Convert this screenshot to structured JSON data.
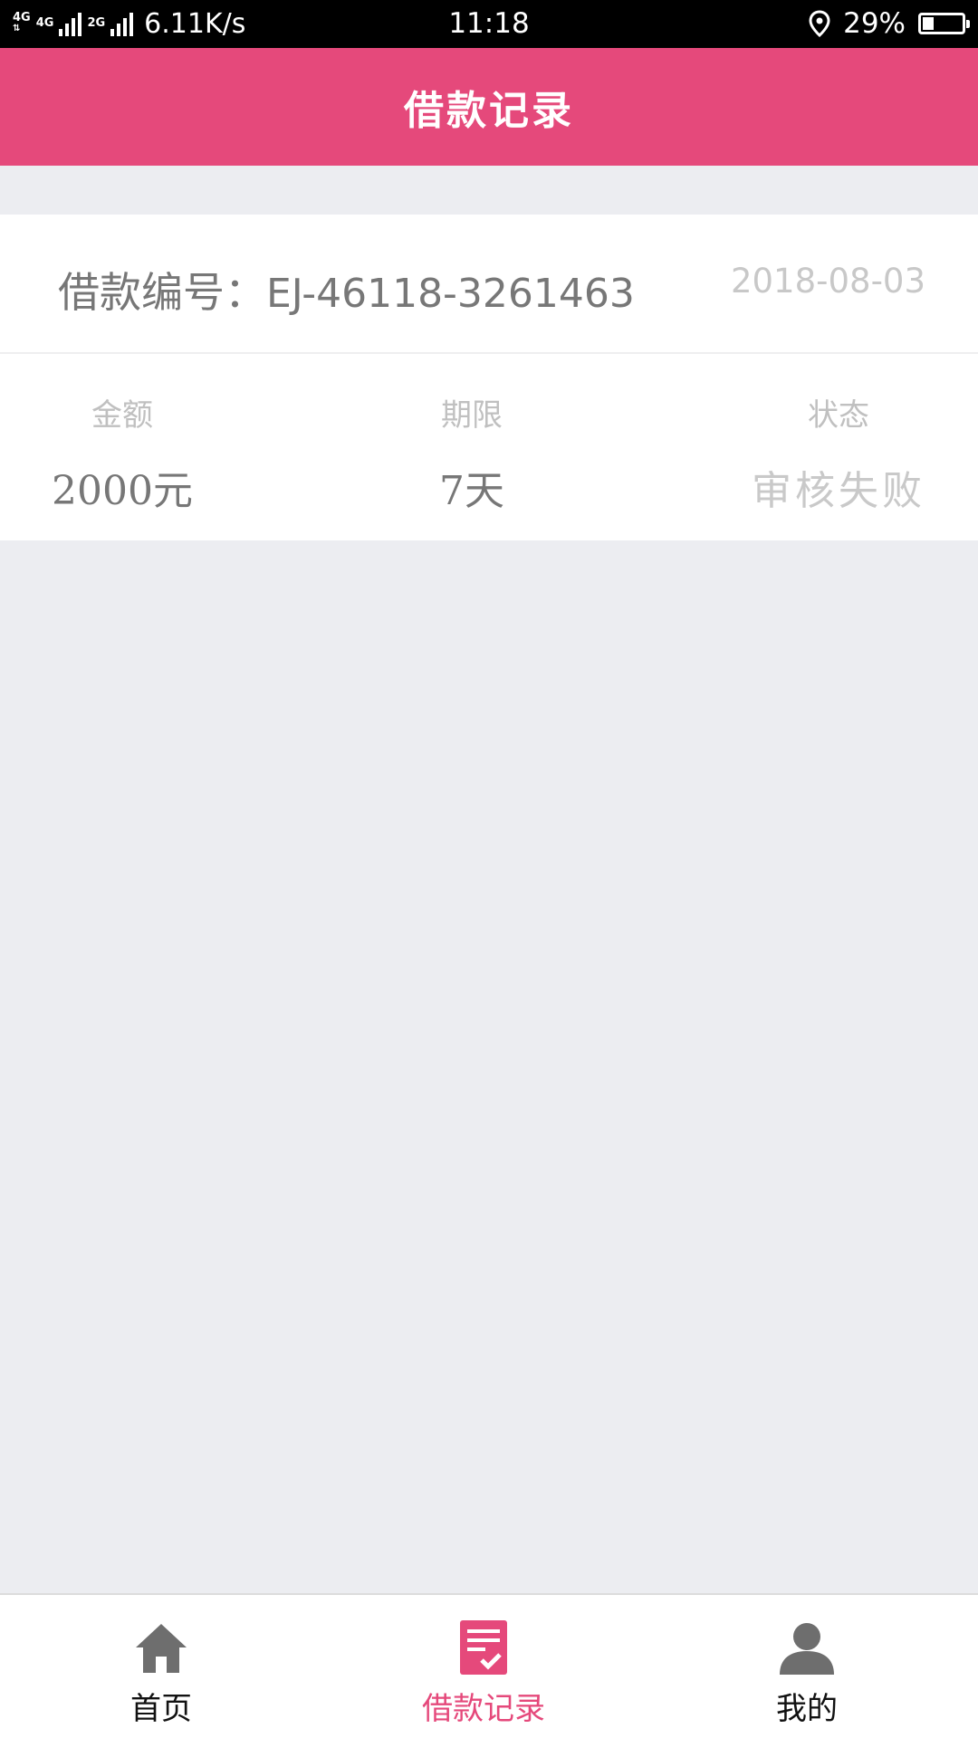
{
  "status_bar": {
    "network_1": "4G",
    "network_2": "4G",
    "network_3": "2G",
    "speed": "6.11K/s",
    "time": "11:18",
    "battery": "29%",
    "battery_level": 0.29
  },
  "header": {
    "title": "借款记录"
  },
  "loan": {
    "number_label": "借款编号：",
    "number": "EJ-46118-3261463",
    "date": "2018-08-03",
    "amount_label": "金额",
    "amount": "2000元",
    "term_label": "期限",
    "term": "7天",
    "status_label": "状态",
    "status": "审核失败"
  },
  "bottom_nav": {
    "items": [
      {
        "label": "首页",
        "icon": "home-icon"
      },
      {
        "label": "借款记录",
        "icon": "loan-records-icon",
        "active": true
      },
      {
        "label": "我的",
        "icon": "profile-icon"
      }
    ]
  },
  "colors": {
    "accent": "#e5497b",
    "background": "#ecedf1"
  }
}
